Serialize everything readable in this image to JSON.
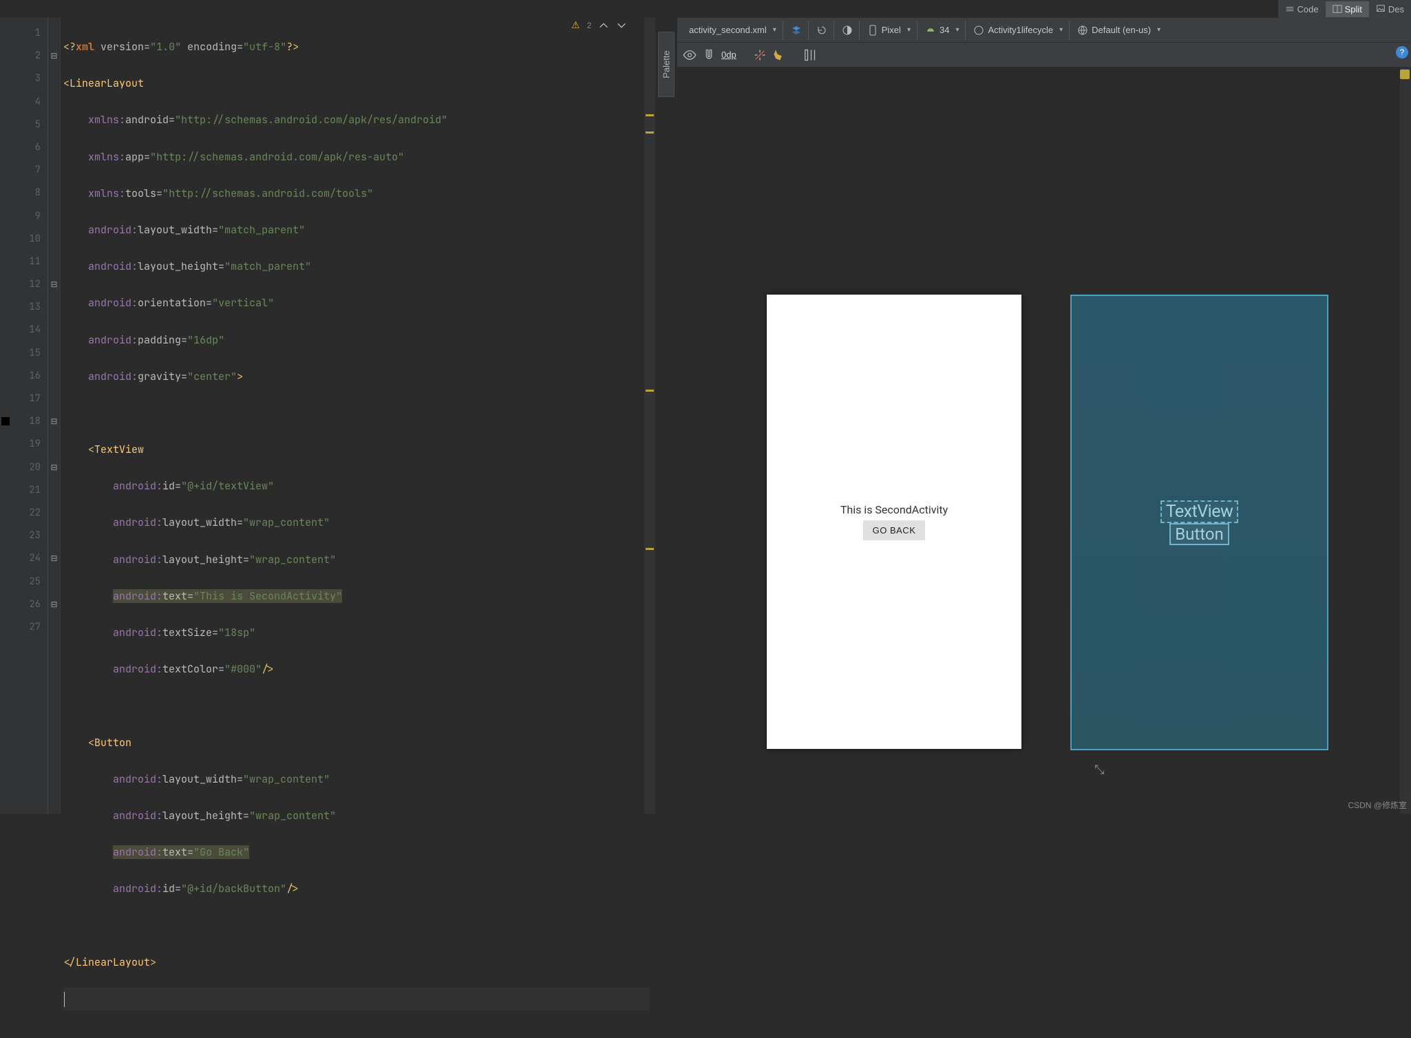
{
  "tabs": {
    "code": "Code",
    "split": "Split",
    "design": "Des"
  },
  "warnings": {
    "count": "2"
  },
  "lines": [
    "1",
    "2",
    "3",
    "4",
    "5",
    "6",
    "7",
    "8",
    "9",
    "10",
    "11",
    "12",
    "13",
    "14",
    "15",
    "16",
    "17",
    "18",
    "19",
    "20",
    "21",
    "22",
    "23",
    "24",
    "25",
    "26",
    "27"
  ],
  "xml": {
    "declVersion": "1.0",
    "declEncoding": "utf-8",
    "rootTag": "LinearLayout",
    "ns_android": "http://schemas.android.com/apk/res/android",
    "ns_app": "http://schemas.android.com/apk/res-auto",
    "ns_tools": "http://schemas.android.com/tools",
    "layout_width": "match_parent",
    "layout_height": "match_parent",
    "orientation": "vertical",
    "padding": "16dp",
    "gravity": "center",
    "textview": {
      "tag": "TextView",
      "id": "@+id/textView",
      "layout_width": "wrap_content",
      "layout_height": "wrap_content",
      "text": "This is SecondActivity",
      "textSize": "18sp",
      "textColor": "#000"
    },
    "button": {
      "tag": "Button",
      "layout_width": "wrap_content",
      "layout_height": "wrap_content",
      "text": "Go Back",
      "id": "@+id/backButton"
    }
  },
  "palette": {
    "label": "Palette"
  },
  "designToolbar": {
    "file": "activity_second.xml",
    "device": "Pixel",
    "api": "34",
    "theme": "Activity1lifecycle",
    "locale": "Default (en-us)"
  },
  "subbar": {
    "dp": "0dp"
  },
  "preview": {
    "text": "This is SecondActivity",
    "button": "GO BACK"
  },
  "blueprint": {
    "textview": "TextView",
    "button": "Button"
  },
  "watermark": "CSDN @修炼室"
}
